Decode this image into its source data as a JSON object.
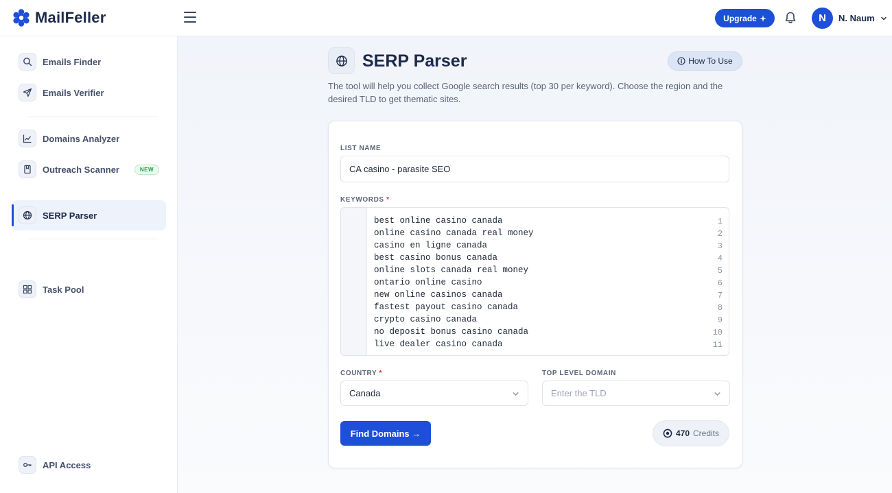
{
  "app": {
    "name": "MailFeller"
  },
  "header": {
    "upgrade_label": "Upgrade",
    "user_initial": "N",
    "user_name": "N. Naum"
  },
  "sidebar": {
    "items": [
      {
        "label": "Emails Finder",
        "icon": "search-icon"
      },
      {
        "label": "Emails Verifier",
        "icon": "send-icon"
      },
      {
        "label": "Domains Analyzer",
        "icon": "chart-line-icon"
      },
      {
        "label": "Outreach Scanner",
        "icon": "bookmark-icon",
        "badge": "NEW"
      },
      {
        "label": "SERP Parser",
        "icon": "globe-icon",
        "active": true
      },
      {
        "label": "Task Pool",
        "icon": "grid-icon"
      },
      {
        "label": "API Access",
        "icon": "key-icon"
      }
    ]
  },
  "page": {
    "title": "SERP Parser",
    "how_to_use": "How To Use",
    "description": "The tool will help you collect Google search results (top 30 per keyword). Choose the region and the desired TLD to get thematic sites."
  },
  "form": {
    "list_name_label": "LIST NAME",
    "list_name_value": "CA casino - parasite SEO",
    "keywords_label": "KEYWORDS",
    "required_mark": "*",
    "keywords": [
      "best online casino canada",
      "online casino canada real money",
      "casino en ligne canada",
      "best casino bonus canada",
      "online slots canada real money",
      "ontario online casino",
      "new online casinos canada",
      "fastest payout casino canada",
      "crypto casino canada",
      "no deposit bonus casino canada",
      "live dealer casino canada"
    ],
    "line_numbers": [
      "1",
      "2",
      "3",
      "4",
      "5",
      "6",
      "7",
      "8",
      "9",
      "10",
      "11"
    ],
    "country_label": "COUNTRY",
    "country_value": "Canada",
    "tld_label": "TOP LEVEL DOMAIN",
    "tld_placeholder": "Enter the TLD",
    "submit_label": "Find Domains →",
    "credits_value": "470",
    "credits_label": "Credits"
  },
  "colors": {
    "primary": "#1d4fd8",
    "text": "#1c2a4a",
    "required": "#dc2626",
    "badge_green": "#16a34a"
  }
}
